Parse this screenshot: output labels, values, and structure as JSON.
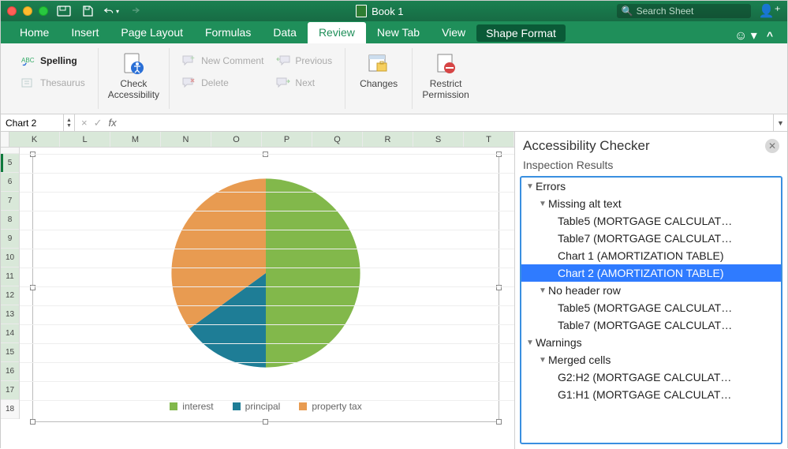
{
  "title": "Book 1",
  "search_placeholder": "Search Sheet",
  "tabs": [
    "Home",
    "Insert",
    "Page Layout",
    "Formulas",
    "Data",
    "Review",
    "New Tab",
    "View",
    "Shape Format"
  ],
  "active_tab": "Review",
  "ribbon": {
    "spelling": "Spelling",
    "thesaurus": "Thesaurus",
    "check_access": "Check\nAccessibility",
    "new_comment": "New Comment",
    "delete": "Delete",
    "previous": "Previous",
    "next": "Next",
    "changes": "Changes",
    "restrict": "Restrict\nPermission"
  },
  "formula_bar": {
    "name": "Chart 2",
    "formula": ""
  },
  "columns": [
    "K",
    "L",
    "M",
    "N",
    "O",
    "P",
    "Q",
    "R",
    "S",
    "T"
  ],
  "rows_start": 4,
  "rows_end": 18,
  "chart_data": {
    "type": "pie",
    "series": [
      {
        "name": "interest",
        "value": 50,
        "color": "#82b84b"
      },
      {
        "name": "principal",
        "value": 15,
        "color": "#1e7d96"
      },
      {
        "name": "property tax",
        "value": 35,
        "color": "#e89b51"
      }
    ]
  },
  "pane": {
    "title": "Accessibility Checker",
    "subtitle": "Inspection Results",
    "tree": [
      {
        "level": 1,
        "expand": true,
        "label": "Errors"
      },
      {
        "level": 2,
        "expand": true,
        "label": "Missing alt text"
      },
      {
        "level": 3,
        "label": "Table5 (MORTGAGE CALCULAT…"
      },
      {
        "level": 3,
        "label": "Table7 (MORTGAGE CALCULAT…"
      },
      {
        "level": 3,
        "label": "Chart 1 (AMORTIZATION TABLE)"
      },
      {
        "level": 3,
        "label": "Chart 2 (AMORTIZATION TABLE)",
        "selected": true
      },
      {
        "level": 2,
        "expand": true,
        "label": "No header row"
      },
      {
        "level": 3,
        "label": "Table5 (MORTGAGE CALCULAT…"
      },
      {
        "level": 3,
        "label": "Table7 (MORTGAGE CALCULAT…"
      },
      {
        "level": 1,
        "expand": true,
        "label": "Warnings"
      },
      {
        "level": 2,
        "expand": true,
        "label": "Merged cells"
      },
      {
        "level": 3,
        "label": "G2:H2 (MORTGAGE CALCULAT…"
      },
      {
        "level": 3,
        "label": "G1:H1 (MORTGAGE CALCULAT…"
      }
    ]
  }
}
